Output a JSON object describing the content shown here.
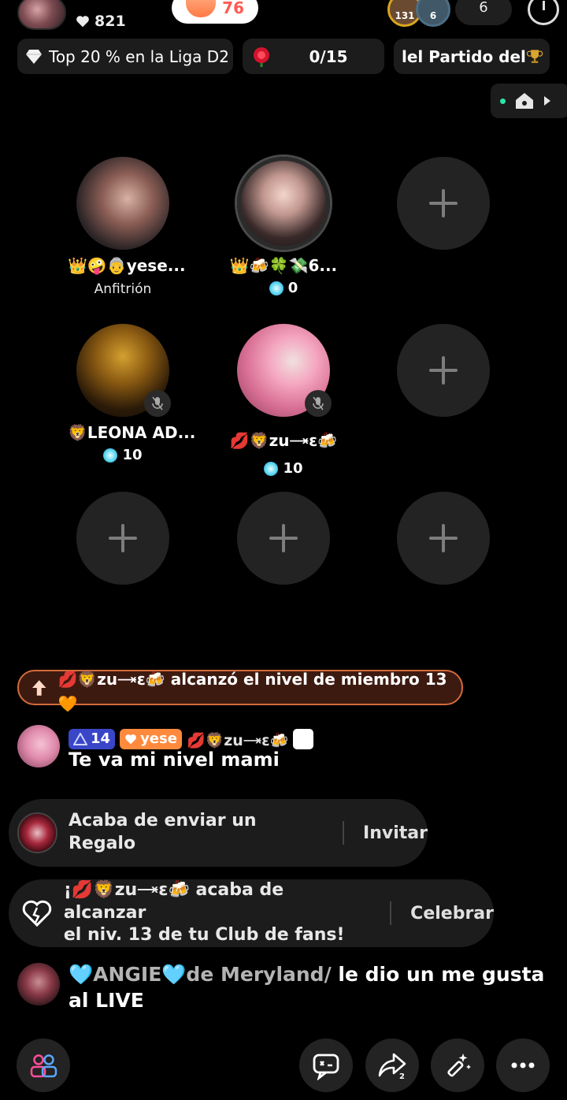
{
  "header": {
    "likes": "821",
    "heart_score": "76",
    "viewer_levels": [
      "131",
      "6"
    ],
    "viewer_count": "6"
  },
  "badges": {
    "league": "Top 20 % en la Liga D2",
    "rose_progress": "0/15",
    "match": "lel Partido del"
  },
  "seats": [
    {
      "name": "👑🤪👵yese...",
      "role": "Anfitrión"
    },
    {
      "name": "👑🍻🍀💸6...",
      "gems": "0"
    },
    {
      "name": "🦁LEONA AD...",
      "gems": "10"
    },
    {
      "name": "💋🦁zu🝐ɛ🍻",
      "gems": "10"
    }
  ],
  "level_banner": "💋🦁zu🝐ɛ🍻 alcanzó el nivel de miembro 13 🧡",
  "chat": {
    "level": "14",
    "fan_tag": "yese",
    "username": "💋🦁zu🝐ɛ🍻",
    "message": "Te va mi nivel mami"
  },
  "notifications": {
    "gift_text": "Acaba de enviar un Regalo",
    "gift_action": "Invitar",
    "fan_text_line1": "¡💋🦁zu🝐ɛ🍻 acaba de alcanzar",
    "fan_text_line2": "el niv. 13 de tu Club de fans!",
    "fan_action": "Celebrar"
  },
  "like_event": {
    "username": "🩵ANGIE🩵de Meryland/",
    "text_rest": " le dio un me gusta al LIVE"
  },
  "bottom": {
    "share_count": "2"
  },
  "colors": {
    "accent_orange": "#ff8a3d",
    "banner_border": "#d36a3d",
    "level_tag": "#3a46c8",
    "gem": "#5ad6f0"
  }
}
